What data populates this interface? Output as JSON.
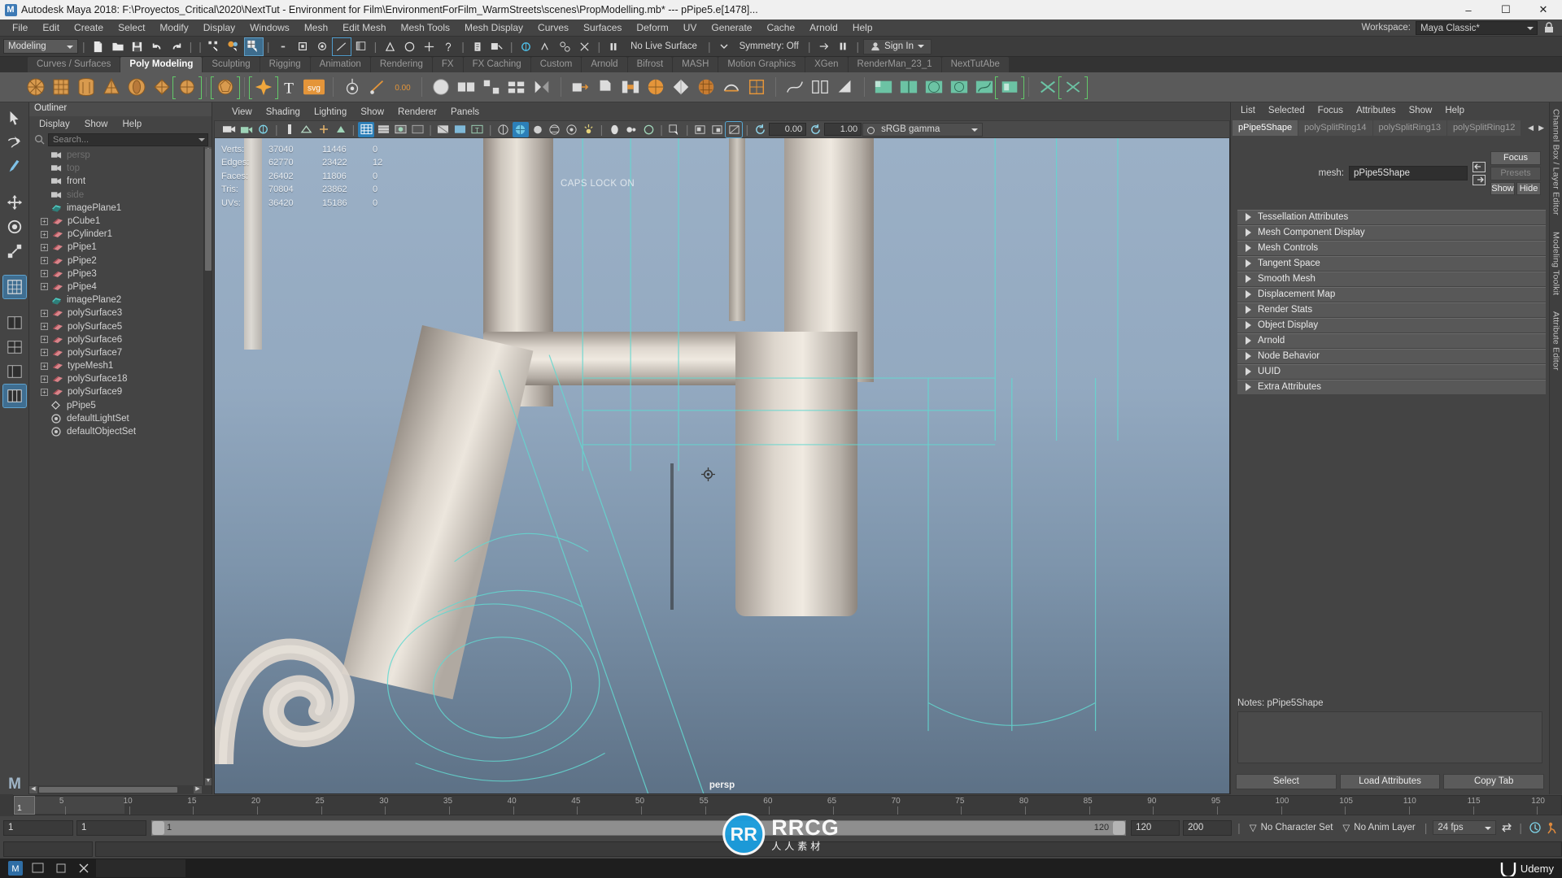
{
  "titlebar": {
    "app_icon": "maya-logo-icon",
    "title": "Autodesk Maya 2018: F:\\Proyectos_Critical\\2020\\NextTut - Environment for Film\\EnvironmentForFilm_WarmStreets\\scenes\\PropModelling.mb*   ---   pPipe5.e[1478]...",
    "minimize": "–",
    "maximize": "☐",
    "close": "✕"
  },
  "menubar": {
    "items": [
      "File",
      "Edit",
      "Create",
      "Select",
      "Modify",
      "Display",
      "Windows",
      "Mesh",
      "Edit Mesh",
      "Mesh Tools",
      "Mesh Display",
      "Curves",
      "Surfaces",
      "Deform",
      "UV",
      "Generate",
      "Cache",
      "Arnold",
      "Help"
    ],
    "workspace_label": "Workspace:",
    "workspace_value": "Maya Classic*"
  },
  "statusbar": {
    "mode": "Modeling",
    "no_live_surface": "No Live Surface",
    "symmetry": "Symmetry: Off",
    "signin": "Sign In",
    "transform_value": "0.00"
  },
  "shelf": {
    "tabs": [
      "Curves / Surfaces",
      "Poly Modeling",
      "Sculpting",
      "Rigging",
      "Animation",
      "Rendering",
      "FX",
      "FX Caching",
      "Custom",
      "Arnold",
      "Bifrost",
      "MASH",
      "Motion Graphics",
      "XGen",
      "RenderMan_23_1",
      "NextTutAbe"
    ],
    "active_tab": "Poly Modeling"
  },
  "outliner": {
    "title": "Outliner",
    "menu": [
      "Display",
      "Show",
      "Help"
    ],
    "search_placeholder": "Search...",
    "items": [
      {
        "label": "persp",
        "icon": "camera-icon",
        "expandable": false,
        "dim": true
      },
      {
        "label": "top",
        "icon": "camera-icon",
        "expandable": false,
        "dim": true
      },
      {
        "label": "front",
        "icon": "camera-icon",
        "expandable": false,
        "dim": false
      },
      {
        "label": "side",
        "icon": "camera-icon",
        "expandable": false,
        "dim": true
      },
      {
        "label": "imagePlane1",
        "icon": "imageplane-icon",
        "expandable": false,
        "dim": false
      },
      {
        "label": "pCube1",
        "icon": "mesh-icon",
        "expandable": true,
        "dim": false
      },
      {
        "label": "pCylinder1",
        "icon": "mesh-icon",
        "expandable": true,
        "dim": false
      },
      {
        "label": "pPipe1",
        "icon": "mesh-icon",
        "expandable": true,
        "dim": false
      },
      {
        "label": "pPipe2",
        "icon": "mesh-icon",
        "expandable": true,
        "dim": false
      },
      {
        "label": "pPipe3",
        "icon": "mesh-icon",
        "expandable": true,
        "dim": false
      },
      {
        "label": "pPipe4",
        "icon": "mesh-icon",
        "expandable": true,
        "dim": false
      },
      {
        "label": "imagePlane2",
        "icon": "imageplane-icon",
        "expandable": false,
        "dim": false
      },
      {
        "label": "polySurface3",
        "icon": "mesh-icon",
        "expandable": true,
        "dim": false
      },
      {
        "label": "polySurface5",
        "icon": "mesh-icon",
        "expandable": true,
        "dim": false
      },
      {
        "label": "polySurface6",
        "icon": "mesh-icon",
        "expandable": true,
        "dim": false
      },
      {
        "label": "polySurface7",
        "icon": "mesh-icon",
        "expandable": true,
        "dim": false
      },
      {
        "label": "typeMesh1",
        "icon": "mesh-icon",
        "expandable": true,
        "dim": false
      },
      {
        "label": "polySurface18",
        "icon": "mesh-icon",
        "expandable": true,
        "dim": false
      },
      {
        "label": "polySurface9",
        "icon": "mesh-icon",
        "expandable": true,
        "dim": false
      },
      {
        "label": "pPipe5",
        "icon": "component-icon",
        "expandable": false,
        "dim": false
      },
      {
        "label": "defaultLightSet",
        "icon": "set-icon",
        "expandable": false,
        "dim": false
      },
      {
        "label": "defaultObjectSet",
        "icon": "set-icon",
        "expandable": false,
        "dim": false
      }
    ]
  },
  "viewport": {
    "menu": [
      "View",
      "Shading",
      "Lighting",
      "Show",
      "Renderer",
      "Panels"
    ],
    "exposure": "0.00",
    "gamma": "1.00",
    "colorspace": "sRGB gamma",
    "camera_label": "persp",
    "capslock": "CAPS LOCK ON",
    "hud": {
      "rows": [
        {
          "name": "Verts:",
          "a": "37040",
          "b": "11446",
          "c": "0"
        },
        {
          "name": "Edges:",
          "a": "62770",
          "b": "23422",
          "c": "12"
        },
        {
          "name": "Faces:",
          "a": "26402",
          "b": "11806",
          "c": "0"
        },
        {
          "name": "Tris:",
          "a": "70804",
          "b": "23862",
          "c": "0"
        },
        {
          "name": "UVs:",
          "a": "36420",
          "b": "15186",
          "c": "0"
        }
      ]
    }
  },
  "attribute_editor": {
    "menu": [
      "List",
      "Selected",
      "Focus",
      "Attributes",
      "Show",
      "Help"
    ],
    "tabs": [
      "pPipe5Shape",
      "polySplitRing14",
      "polySplitRing13",
      "polySplitRing12"
    ],
    "active_tab": "pPipe5Shape",
    "mesh_label": "mesh:",
    "mesh_value": "pPipe5Shape",
    "buttons": {
      "focus": "Focus",
      "presets": "Presets",
      "show": "Show",
      "hide": "Hide"
    },
    "sections": [
      "Tessellation Attributes",
      "Mesh Component Display",
      "Mesh Controls",
      "Tangent Space",
      "Smooth Mesh",
      "Displacement Map",
      "Render Stats",
      "Object Display",
      "Arnold",
      "Node Behavior",
      "UUID",
      "Extra Attributes"
    ],
    "notes_label": "Notes:",
    "notes_value": "pPipe5Shape",
    "footer": [
      "Select",
      "Load Attributes",
      "Copy Tab"
    ],
    "side_tabs": [
      "Channel Box / Layer Editor",
      "Modeling Toolkit",
      "Attribute Editor"
    ]
  },
  "timeline": {
    "current_frame": "1",
    "ticks": [
      5,
      10,
      15,
      20,
      25,
      30,
      35,
      40,
      45,
      50,
      55,
      60,
      65,
      70,
      75,
      80,
      85,
      90,
      95,
      100,
      105,
      110,
      115,
      120
    ],
    "start_field": "1",
    "start_field2": "1",
    "range_start": "1",
    "range_end": "120",
    "anim_end": "120",
    "playback_end": "200",
    "character_set": "No Character Set",
    "anim_layer": "No Anim Layer",
    "fps": "24 fps",
    "goto_frame": "1"
  },
  "watermark": {
    "logo_text": "RR",
    "main": "RRCG",
    "sub": "人人素材"
  },
  "taskbar": {
    "udemy": "Udemy"
  }
}
